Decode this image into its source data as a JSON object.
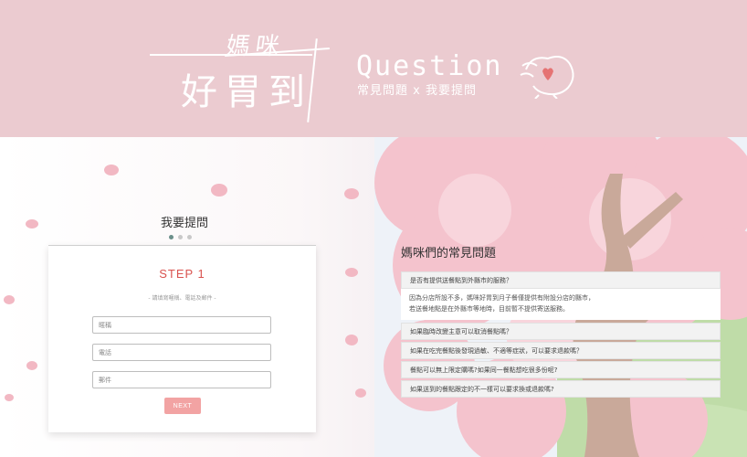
{
  "banner": {
    "logo_small": "媽咪",
    "logo_big": "好胃到",
    "question_title": "Question",
    "question_subtitle": "常見問題 x 我要提問",
    "bg_color": "#ebcbd0",
    "mascot_icon": "mascot-pot-heart-icon"
  },
  "form": {
    "heading": "我要提問",
    "step_count": 3,
    "active_step": 1,
    "step_label": "STEP 1",
    "hint": "- 請填寫暱稱、電話及郵件 -",
    "fields": [
      {
        "placeholder": "暱稱"
      },
      {
        "placeholder": "電話"
      },
      {
        "placeholder": "郵件"
      }
    ],
    "next_label": "NEXT",
    "accent_color": "#f2a3a3",
    "step_color": "#d9534f"
  },
  "faq": {
    "title": "媽咪們的常見問題",
    "items": [
      {
        "question": "是否有提供送餐點到外縣市的服務？"
      },
      {
        "question": "如果臨時改變主意可以取消餐點嗎？"
      },
      {
        "question": "如果在吃完餐點後發現過敏、不適等症狀，可以要求退款嗎？"
      },
      {
        "question": "餐點可以無上限定購嗎?如果同一餐點想吃很多份呢?"
      },
      {
        "question": "如果送到的餐點跟定的不一樣可以要求換或退款嗎?"
      }
    ],
    "expanded_answer": [
      "因為分店所設不多，媽咪好胃到月子餐僅提供有附設分店的縣市，",
      "若送餐地點是在外縣市等地時，目前暫不提供寄送服務。"
    ]
  }
}
